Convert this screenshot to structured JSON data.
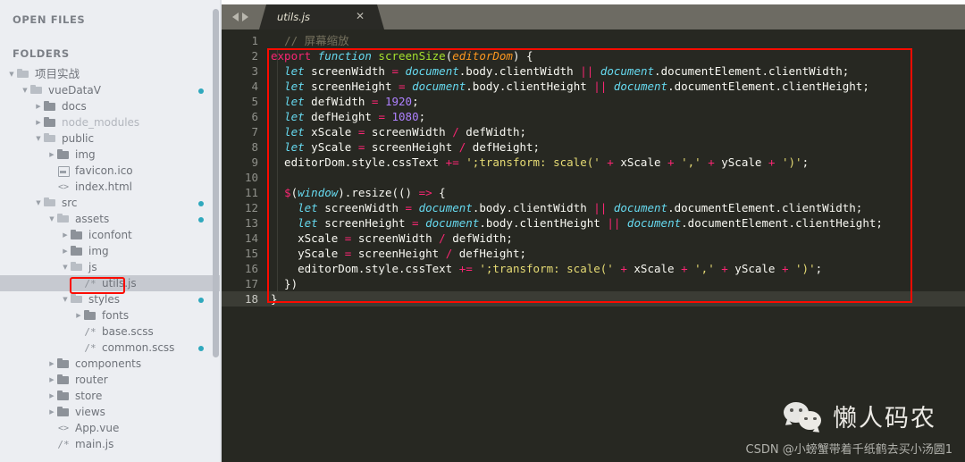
{
  "sidebar": {
    "open_files_heading": "OPEN FILES",
    "folders_heading": "FOLDERS",
    "tree": [
      {
        "label": "项目实战",
        "depth": 0,
        "twisty": "▼",
        "icon": "folder-open",
        "dot": false,
        "dim": false,
        "selected": false,
        "cjk": true
      },
      {
        "label": "vueDataV",
        "depth": 1,
        "twisty": "▼",
        "icon": "folder-open",
        "dot": true,
        "dim": false,
        "selected": false,
        "cjk": false
      },
      {
        "label": "docs",
        "depth": 2,
        "twisty": "▶",
        "icon": "folder-closed",
        "dot": false,
        "dim": false,
        "selected": false,
        "cjk": false
      },
      {
        "label": "node_modules",
        "depth": 2,
        "twisty": "▶",
        "icon": "folder-closed",
        "dot": false,
        "dim": true,
        "selected": false,
        "cjk": false
      },
      {
        "label": "public",
        "depth": 2,
        "twisty": "▼",
        "icon": "folder-open",
        "dot": false,
        "dim": false,
        "selected": false,
        "cjk": false
      },
      {
        "label": "img",
        "depth": 3,
        "twisty": "▶",
        "icon": "folder-closed",
        "dot": false,
        "dim": false,
        "selected": false,
        "cjk": false
      },
      {
        "label": "favicon.ico",
        "depth": 3,
        "twisty": "",
        "icon": "file-image",
        "dot": false,
        "dim": false,
        "selected": false,
        "cjk": false
      },
      {
        "label": "index.html",
        "depth": 3,
        "twisty": "",
        "icon": "file-angle",
        "dot": false,
        "dim": false,
        "selected": false,
        "cjk": false
      },
      {
        "label": "src",
        "depth": 2,
        "twisty": "▼",
        "icon": "folder-open",
        "dot": true,
        "dim": false,
        "selected": false,
        "cjk": false
      },
      {
        "label": "assets",
        "depth": 3,
        "twisty": "▼",
        "icon": "folder-open",
        "dot": true,
        "dim": false,
        "selected": false,
        "cjk": false
      },
      {
        "label": "iconfont",
        "depth": 4,
        "twisty": "▶",
        "icon": "folder-closed",
        "dot": false,
        "dim": false,
        "selected": false,
        "cjk": false
      },
      {
        "label": "img",
        "depth": 4,
        "twisty": "▶",
        "icon": "folder-closed",
        "dot": false,
        "dim": false,
        "selected": false,
        "cjk": false
      },
      {
        "label": "js",
        "depth": 4,
        "twisty": "▼",
        "icon": "folder-open",
        "dot": false,
        "dim": false,
        "selected": false,
        "cjk": false
      },
      {
        "label": "utils.js",
        "depth": 5,
        "twisty": "",
        "icon": "file-code-comment",
        "dot": false,
        "dim": false,
        "selected": true,
        "cjk": false
      },
      {
        "label": "styles",
        "depth": 4,
        "twisty": "▼",
        "icon": "folder-open",
        "dot": true,
        "dim": false,
        "selected": false,
        "cjk": false
      },
      {
        "label": "fonts",
        "depth": 5,
        "twisty": "▶",
        "icon": "folder-closed",
        "dot": false,
        "dim": false,
        "selected": false,
        "cjk": false
      },
      {
        "label": "base.scss",
        "depth": 5,
        "twisty": "",
        "icon": "file-code-comment",
        "dot": false,
        "dim": false,
        "selected": false,
        "cjk": false
      },
      {
        "label": "common.scss",
        "depth": 5,
        "twisty": "",
        "icon": "file-code-comment",
        "dot": true,
        "dim": false,
        "selected": false,
        "cjk": false
      },
      {
        "label": "components",
        "depth": 3,
        "twisty": "▶",
        "icon": "folder-closed",
        "dot": false,
        "dim": false,
        "selected": false,
        "cjk": false
      },
      {
        "label": "router",
        "depth": 3,
        "twisty": "▶",
        "icon": "folder-closed",
        "dot": false,
        "dim": false,
        "selected": false,
        "cjk": false
      },
      {
        "label": "store",
        "depth": 3,
        "twisty": "▶",
        "icon": "folder-closed",
        "dot": false,
        "dim": false,
        "selected": false,
        "cjk": false
      },
      {
        "label": "views",
        "depth": 3,
        "twisty": "▶",
        "icon": "folder-closed",
        "dot": false,
        "dim": false,
        "selected": false,
        "cjk": false
      },
      {
        "label": "App.vue",
        "depth": 3,
        "twisty": "",
        "icon": "file-angle",
        "dot": false,
        "dim": false,
        "selected": false,
        "cjk": false
      },
      {
        "label": "main.js",
        "depth": 3,
        "twisty": "",
        "icon": "file-code-comment",
        "dot": false,
        "dim": false,
        "selected": false,
        "cjk": false
      }
    ]
  },
  "tabbar": {
    "nav_back": "◀",
    "nav_forward": "▶",
    "tab_title": "utils.js",
    "close_label": "✕"
  },
  "editor": {
    "active_line": 18,
    "line_numbers": [
      "1",
      "2",
      "3",
      "4",
      "5",
      "6",
      "7",
      "8",
      "9",
      "10",
      "11",
      "12",
      "13",
      "14",
      "15",
      "16",
      "17",
      "18"
    ],
    "lines": [
      {
        "n": 1,
        "tokens": [
          {
            "t": "  ",
            "c": "t-plain"
          },
          {
            "t": "// 屏幕缩放",
            "c": "t-com"
          }
        ]
      },
      {
        "n": 2,
        "tokens": [
          {
            "t": "export ",
            "c": "t-kw"
          },
          {
            "t": "function ",
            "c": "t-kw2"
          },
          {
            "t": "screenSize",
            "c": "t-fn"
          },
          {
            "t": "(",
            "c": "t-plain"
          },
          {
            "t": "editorDom",
            "c": "t-par"
          },
          {
            "t": ") {",
            "c": "t-plain"
          }
        ]
      },
      {
        "n": 3,
        "tokens": [
          {
            "t": "  ",
            "c": "t-plain"
          },
          {
            "t": "let",
            "c": "t-kw2"
          },
          {
            "t": " screenWidth ",
            "c": "t-plain"
          },
          {
            "t": "=",
            "c": "t-op"
          },
          {
            "t": " ",
            "c": "t-plain"
          },
          {
            "t": "document",
            "c": "t-obj"
          },
          {
            "t": ".body.clientWidth ",
            "c": "t-plain"
          },
          {
            "t": "||",
            "c": "t-op"
          },
          {
            "t": " ",
            "c": "t-plain"
          },
          {
            "t": "document",
            "c": "t-obj"
          },
          {
            "t": ".documentElement.clientWidth;",
            "c": "t-plain"
          }
        ]
      },
      {
        "n": 4,
        "tokens": [
          {
            "t": "  ",
            "c": "t-plain"
          },
          {
            "t": "let",
            "c": "t-kw2"
          },
          {
            "t": " screenHeight ",
            "c": "t-plain"
          },
          {
            "t": "=",
            "c": "t-op"
          },
          {
            "t": " ",
            "c": "t-plain"
          },
          {
            "t": "document",
            "c": "t-obj"
          },
          {
            "t": ".body.clientHeight ",
            "c": "t-plain"
          },
          {
            "t": "||",
            "c": "t-op"
          },
          {
            "t": " ",
            "c": "t-plain"
          },
          {
            "t": "document",
            "c": "t-obj"
          },
          {
            "t": ".documentElement.clientHeight;",
            "c": "t-plain"
          }
        ]
      },
      {
        "n": 5,
        "tokens": [
          {
            "t": "  ",
            "c": "t-plain"
          },
          {
            "t": "let",
            "c": "t-kw2"
          },
          {
            "t": " defWidth ",
            "c": "t-plain"
          },
          {
            "t": "=",
            "c": "t-op"
          },
          {
            "t": " ",
            "c": "t-plain"
          },
          {
            "t": "1920",
            "c": "t-num"
          },
          {
            "t": ";",
            "c": "t-plain"
          }
        ]
      },
      {
        "n": 6,
        "tokens": [
          {
            "t": "  ",
            "c": "t-plain"
          },
          {
            "t": "let",
            "c": "t-kw2"
          },
          {
            "t": " defHeight ",
            "c": "t-plain"
          },
          {
            "t": "=",
            "c": "t-op"
          },
          {
            "t": " ",
            "c": "t-plain"
          },
          {
            "t": "1080",
            "c": "t-num"
          },
          {
            "t": ";",
            "c": "t-plain"
          }
        ]
      },
      {
        "n": 7,
        "tokens": [
          {
            "t": "  ",
            "c": "t-plain"
          },
          {
            "t": "let",
            "c": "t-kw2"
          },
          {
            "t": " xScale ",
            "c": "t-plain"
          },
          {
            "t": "=",
            "c": "t-op"
          },
          {
            "t": " screenWidth ",
            "c": "t-plain"
          },
          {
            "t": "/",
            "c": "t-op"
          },
          {
            "t": " defWidth;",
            "c": "t-plain"
          }
        ]
      },
      {
        "n": 8,
        "tokens": [
          {
            "t": "  ",
            "c": "t-plain"
          },
          {
            "t": "let",
            "c": "t-kw2"
          },
          {
            "t": " yScale ",
            "c": "t-plain"
          },
          {
            "t": "=",
            "c": "t-op"
          },
          {
            "t": " screenHeight ",
            "c": "t-plain"
          },
          {
            "t": "/",
            "c": "t-op"
          },
          {
            "t": " defHeight;",
            "c": "t-plain"
          }
        ]
      },
      {
        "n": 9,
        "tokens": [
          {
            "t": "  editorDom.style.cssText ",
            "c": "t-plain"
          },
          {
            "t": "+=",
            "c": "t-op"
          },
          {
            "t": " ",
            "c": "t-plain"
          },
          {
            "t": "';transform: scale('",
            "c": "t-str"
          },
          {
            "t": " + ",
            "c": "t-op"
          },
          {
            "t": "xScale",
            "c": "t-plain"
          },
          {
            "t": " + ",
            "c": "t-op"
          },
          {
            "t": "','",
            "c": "t-str"
          },
          {
            "t": " + ",
            "c": "t-op"
          },
          {
            "t": "yScale",
            "c": "t-plain"
          },
          {
            "t": " + ",
            "c": "t-op"
          },
          {
            "t": "')'",
            "c": "t-str"
          },
          {
            "t": ";",
            "c": "t-plain"
          }
        ]
      },
      {
        "n": 10,
        "tokens": [
          {
            "t": "",
            "c": "t-plain"
          }
        ]
      },
      {
        "n": 11,
        "tokens": [
          {
            "t": "  ",
            "c": "t-plain"
          },
          {
            "t": "$",
            "c": "t-kw"
          },
          {
            "t": "(",
            "c": "t-plain"
          },
          {
            "t": "window",
            "c": "t-obj"
          },
          {
            "t": ").resize(() ",
            "c": "t-plain"
          },
          {
            "t": "=>",
            "c": "t-op"
          },
          {
            "t": " {",
            "c": "t-plain"
          }
        ]
      },
      {
        "n": 12,
        "tokens": [
          {
            "t": "    ",
            "c": "t-plain"
          },
          {
            "t": "let",
            "c": "t-kw2"
          },
          {
            "t": " screenWidth ",
            "c": "t-plain"
          },
          {
            "t": "=",
            "c": "t-op"
          },
          {
            "t": " ",
            "c": "t-plain"
          },
          {
            "t": "document",
            "c": "t-obj"
          },
          {
            "t": ".body.clientWidth ",
            "c": "t-plain"
          },
          {
            "t": "||",
            "c": "t-op"
          },
          {
            "t": " ",
            "c": "t-plain"
          },
          {
            "t": "document",
            "c": "t-obj"
          },
          {
            "t": ".documentElement.clientWidth;",
            "c": "t-plain"
          }
        ]
      },
      {
        "n": 13,
        "tokens": [
          {
            "t": "    ",
            "c": "t-plain"
          },
          {
            "t": "let",
            "c": "t-kw2"
          },
          {
            "t": " screenHeight ",
            "c": "t-plain"
          },
          {
            "t": "=",
            "c": "t-op"
          },
          {
            "t": " ",
            "c": "t-plain"
          },
          {
            "t": "document",
            "c": "t-obj"
          },
          {
            "t": ".body.clientHeight ",
            "c": "t-plain"
          },
          {
            "t": "||",
            "c": "t-op"
          },
          {
            "t": " ",
            "c": "t-plain"
          },
          {
            "t": "document",
            "c": "t-obj"
          },
          {
            "t": ".documentElement.clientHeight;",
            "c": "t-plain"
          }
        ]
      },
      {
        "n": 14,
        "tokens": [
          {
            "t": "    xScale ",
            "c": "t-plain"
          },
          {
            "t": "=",
            "c": "t-op"
          },
          {
            "t": " screenWidth ",
            "c": "t-plain"
          },
          {
            "t": "/",
            "c": "t-op"
          },
          {
            "t": " defWidth;",
            "c": "t-plain"
          }
        ]
      },
      {
        "n": 15,
        "tokens": [
          {
            "t": "    yScale ",
            "c": "t-plain"
          },
          {
            "t": "=",
            "c": "t-op"
          },
          {
            "t": " screenHeight ",
            "c": "t-plain"
          },
          {
            "t": "/",
            "c": "t-op"
          },
          {
            "t": " defHeight;",
            "c": "t-plain"
          }
        ]
      },
      {
        "n": 16,
        "tokens": [
          {
            "t": "    editorDom.style.cssText ",
            "c": "t-plain"
          },
          {
            "t": "+=",
            "c": "t-op"
          },
          {
            "t": " ",
            "c": "t-plain"
          },
          {
            "t": "';transform: scale('",
            "c": "t-str"
          },
          {
            "t": " + ",
            "c": "t-op"
          },
          {
            "t": "xScale",
            "c": "t-plain"
          },
          {
            "t": " + ",
            "c": "t-op"
          },
          {
            "t": "','",
            "c": "t-str"
          },
          {
            "t": " + ",
            "c": "t-op"
          },
          {
            "t": "yScale",
            "c": "t-plain"
          },
          {
            "t": " + ",
            "c": "t-op"
          },
          {
            "t": "')'",
            "c": "t-str"
          },
          {
            "t": ";",
            "c": "t-plain"
          }
        ]
      },
      {
        "n": 17,
        "tokens": [
          {
            "t": "  })",
            "c": "t-plain"
          }
        ]
      },
      {
        "n": 18,
        "tokens": [
          {
            "t": "}",
            "c": "t-plain"
          }
        ]
      }
    ]
  },
  "watermark": {
    "brand_name": "懒人码农",
    "csdn_text": "CSDN @小螃蟹带着千纸鹤去买小汤圆1"
  },
  "colors": {
    "annotation_red": "#fb0b00",
    "sidebar_bg": "#eceef2",
    "editor_bg": "#272822",
    "status_dot": "#2fa8bd",
    "tabbar_bg": "#6d6b63"
  }
}
